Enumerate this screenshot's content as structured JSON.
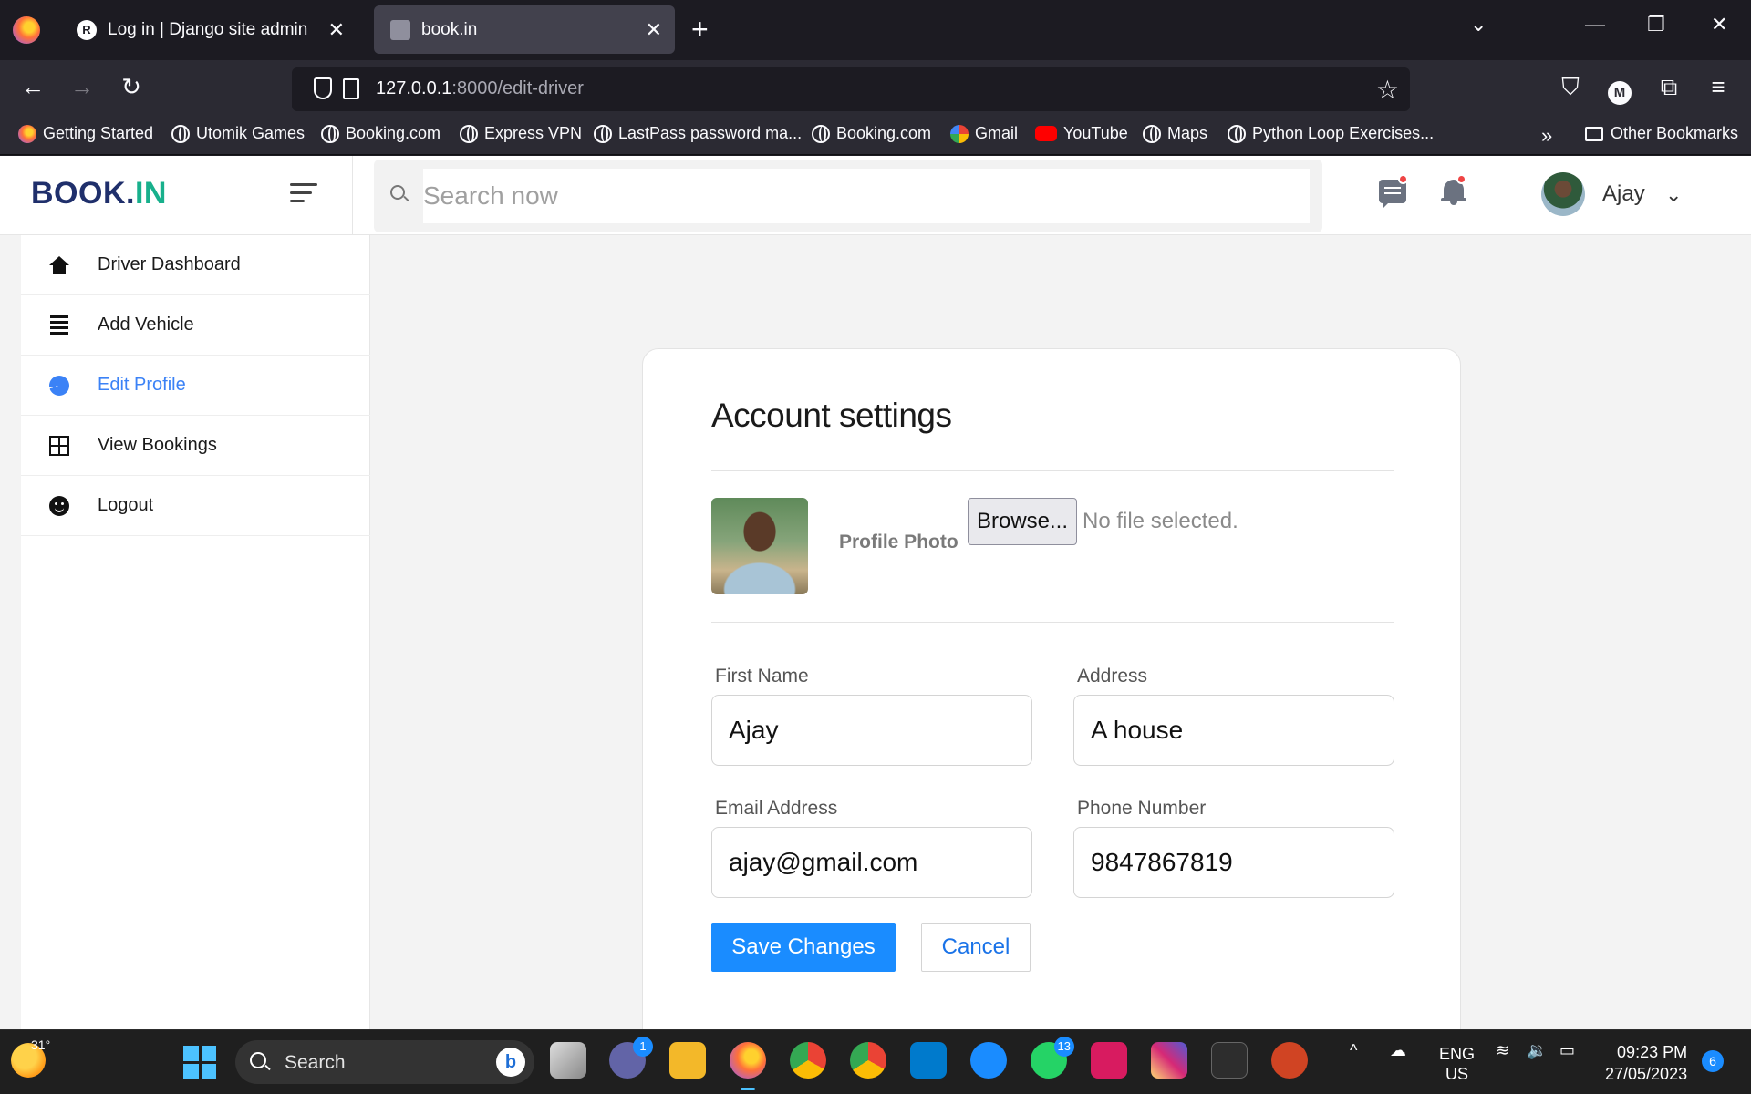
{
  "browser": {
    "tabs": [
      {
        "title": "Log in | Django site admin",
        "active": false
      },
      {
        "title": "book.in",
        "active": true
      }
    ],
    "url": {
      "host": "127.0.0.1",
      "path": ":8000/edit-driver"
    },
    "bookmarks": [
      "Getting Started",
      "Utomik Games",
      "Booking.com",
      "Express VPN",
      "LastPass password ma...",
      "Booking.com",
      "Gmail",
      "YouTube",
      "Maps",
      "Python Loop Exercises..."
    ],
    "other_bookmarks": "Other Bookmarks",
    "account_initial": "M"
  },
  "app": {
    "logo_main": "BOOK.",
    "logo_accent": "IN",
    "search_placeholder": "Search now",
    "user_name": "Ajay",
    "accent_color": "#1a8cff",
    "brand_color": "#1f2f6b"
  },
  "sidebar": {
    "items": [
      {
        "label": "Driver Dashboard",
        "icon": "home-icon",
        "active": false
      },
      {
        "label": "Add Vehicle",
        "icon": "list-icon",
        "active": false
      },
      {
        "label": "Edit Profile",
        "icon": "pie-chart-icon",
        "active": true
      },
      {
        "label": "View Bookings",
        "icon": "grid-icon",
        "active": false
      },
      {
        "label": "Logout",
        "icon": "smile-icon",
        "active": false
      }
    ]
  },
  "form": {
    "title": "Account settings",
    "photo_label": "Profile Photo",
    "browse_label": "Browse...",
    "file_status": "No file selected.",
    "fields": {
      "first_name": {
        "label": "First Name",
        "value": "Ajay"
      },
      "address": {
        "label": "Address",
        "value": "A house"
      },
      "email": {
        "label": "Email Address",
        "value": "ajay@gmail.com"
      },
      "phone": {
        "label": "Phone Number",
        "value": "9847867819"
      }
    },
    "save_label": "Save Changes",
    "cancel_label": "Cancel"
  },
  "taskbar": {
    "weather_temp": "31°",
    "search_label": "Search",
    "meet_badge": "1",
    "whatsapp_badge": "13",
    "lang": "ENG",
    "region": "US",
    "time": "09:23 PM",
    "date": "27/05/2023",
    "notifications": "6"
  }
}
